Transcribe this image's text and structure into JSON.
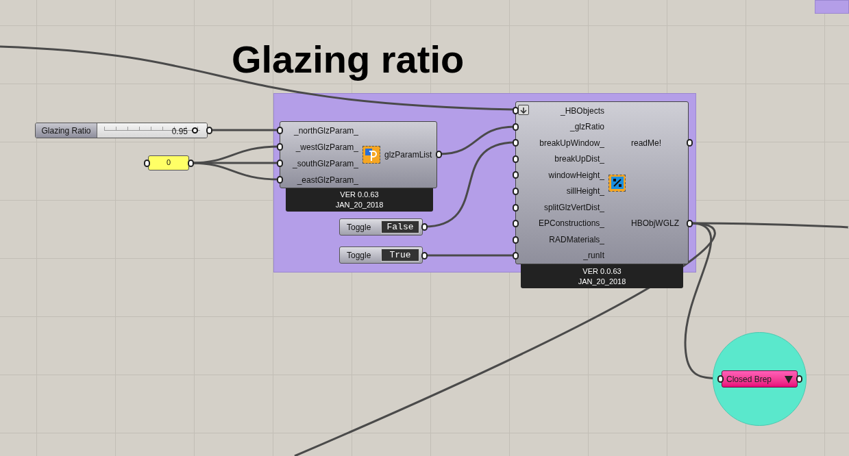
{
  "title": "Glazing ratio",
  "slider": {
    "label": "Glazing Ratio",
    "value": "0.95",
    "level": 0.95
  },
  "panel": {
    "text": "0"
  },
  "param_component": {
    "inputs": [
      "_northGlzParam_",
      "_westGlzParam_",
      "_southGlzParam_",
      "_eastGlzParam_"
    ],
    "output": "glzParamList",
    "version": "VER 0.0.63",
    "date": "JAN_20_2018"
  },
  "toggles": [
    {
      "label": "Toggle",
      "value": "False"
    },
    {
      "label": "Toggle",
      "value": "True"
    }
  ],
  "glazing_component": {
    "inputs": [
      "_HBObjects",
      "_glzRatio",
      "breakUpWindow_",
      "breakUpDist_",
      "windowHeight_",
      "sillHeight_",
      "splitGlzVertDist_",
      "EPConstructions_",
      "RADMaterials_",
      "_runIt"
    ],
    "outputs": [
      "readMe!",
      "HBObjWGLZ"
    ],
    "version": "VER 0.0.63",
    "date": "JAN_20_2018"
  },
  "brep_param": {
    "label": "Closed Brep"
  }
}
